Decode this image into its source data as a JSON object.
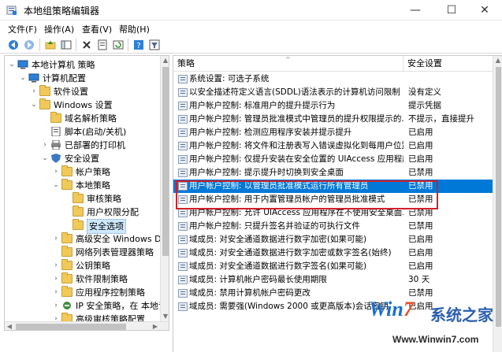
{
  "window": {
    "title": "本地组策略编辑器",
    "minimize_symbol": "—",
    "maximize_symbol": "☐",
    "close_symbol": "✕"
  },
  "menu": [
    "文件(F)",
    "操作(A)",
    "查看(V)",
    "帮助(H)"
  ],
  "toolbar_icons": [
    "back-icon",
    "forward-icon",
    "up-folder-icon",
    "show-hide-tree-icon",
    "delete-icon",
    "properties-icon",
    "refresh-icon",
    "help-icon",
    "filter-icon"
  ],
  "tree": {
    "items": [
      {
        "label": "本地计算机 策略",
        "level": 0,
        "expander": "⌄",
        "icon": "computer-policy-icon"
      },
      {
        "label": "计算机配置",
        "level": 1,
        "expander": "⌄",
        "icon": "computer-icon"
      },
      {
        "label": "软件设置",
        "level": 2,
        "expander": "›",
        "icon": "folder-icon"
      },
      {
        "label": "Windows 设置",
        "level": 2,
        "expander": "⌄",
        "icon": "folder-icon"
      },
      {
        "label": "域名解析策略",
        "level": 3,
        "expander": "",
        "icon": "folder-icon"
      },
      {
        "label": "脚本(启动/关机)",
        "level": 3,
        "expander": "",
        "icon": "script-icon"
      },
      {
        "label": "已部署的打印机",
        "level": 3,
        "expander": "›",
        "icon": "printer-icon"
      },
      {
        "label": "安全设置",
        "level": 3,
        "expander": "⌄",
        "icon": "security-icon"
      },
      {
        "label": "帐户策略",
        "level": 4,
        "expander": "›",
        "icon": "folder-icon"
      },
      {
        "label": "本地策略",
        "level": 4,
        "expander": "⌄",
        "icon": "folder-icon"
      },
      {
        "label": "审核策略",
        "level": 5,
        "expander": "",
        "icon": "folder-icon"
      },
      {
        "label": "用户权限分配",
        "level": 5,
        "expander": "",
        "icon": "folder-icon"
      },
      {
        "label": "安全选项",
        "level": 5,
        "expander": "",
        "icon": "folder-open-icon",
        "selected": true
      },
      {
        "label": "高级安全 Windows Defe",
        "level": 4,
        "expander": "›",
        "icon": "folder-icon"
      },
      {
        "label": "网络列表管理器策略",
        "level": 4,
        "expander": "",
        "icon": "folder-icon"
      },
      {
        "label": "公钥策略",
        "level": 4,
        "expander": "›",
        "icon": "folder-icon"
      },
      {
        "label": "软件限制策略",
        "level": 4,
        "expander": "›",
        "icon": "folder-icon"
      },
      {
        "label": "应用程序控制策略",
        "level": 4,
        "expander": "›",
        "icon": "folder-icon"
      },
      {
        "label": "IP 安全策略，在 本地计",
        "level": 4,
        "expander": "›",
        "icon": "ip-security-icon"
      },
      {
        "label": "高级审核策略配置",
        "level": 4,
        "expander": "›",
        "icon": "folder-icon"
      }
    ]
  },
  "list": {
    "headers": {
      "policy": "策略",
      "setting": "安全设置"
    },
    "rows": [
      {
        "policy": "系统设置: 可选子系统",
        "setting": ""
      },
      {
        "policy": "以安全描述符定义语言(SDDL)语法表示的计算机访问限制",
        "setting": "没有定义"
      },
      {
        "policy": "用户帐户控制: 标准用户的提升提示行为",
        "setting": "提示凭据"
      },
      {
        "policy": "用户帐户控制: 管理员批准模式中管理员的提升权限提示的...",
        "setting": "不提示，直接提升"
      },
      {
        "policy": "用户帐户控制: 检测应用程序安装并提示提升",
        "setting": "已启用"
      },
      {
        "policy": "用户帐户控制: 将文件和注册表写入错误虚拟化到每用户位置",
        "setting": "已启用"
      },
      {
        "policy": "用户帐户控制: 仅提升安装在安全位置的 UIAccess 应用程序",
        "setting": "已启用"
      },
      {
        "policy": "用户帐户控制: 提示提升时切换到安全桌面",
        "setting": "已禁用"
      },
      {
        "policy": "用户帐户控制: 以管理员批准模式运行所有管理员",
        "setting": "已禁用",
        "selected": true
      },
      {
        "policy": "用户帐户控制: 用于内置管理员帐户的管理员批准模式",
        "setting": "已禁用"
      },
      {
        "policy": "用户帐户控制: 允许 UIAccess 应用程序在不使用安全桌面...",
        "setting": "已禁用"
      },
      {
        "policy": "用户帐户控制: 只提升签名并验证的可执行文件",
        "setting": "已禁用"
      },
      {
        "policy": "域成员: 对安全通道数据进行数字加密(如果可能)",
        "setting": "已启用"
      },
      {
        "policy": "域成员: 对安全通道数据进行数字加密或数字签名(始终)",
        "setting": "已启用"
      },
      {
        "policy": "域成员: 对安全通道数据进行数字签名(如果可能)",
        "setting": "已启用"
      },
      {
        "policy": "域成员: 计算机帐户密码最长使用期限",
        "setting": "30 天"
      },
      {
        "policy": "域成员: 禁用计算机帐户密码更改",
        "setting": "已禁用"
      },
      {
        "policy": "域成员: 需要强(Windows 2000 或更高版本)会话密钥",
        "setting": "已启用"
      }
    ]
  },
  "watermark": {
    "logo_prefix": "Win",
    "logo_seven": "7",
    "logo_cn": "系统之家",
    "url": "Www.Winwin7.com"
  },
  "colors": {
    "selection": "#0078d7",
    "highlight_box": "#d0202a",
    "folder": "#f0c95a"
  }
}
